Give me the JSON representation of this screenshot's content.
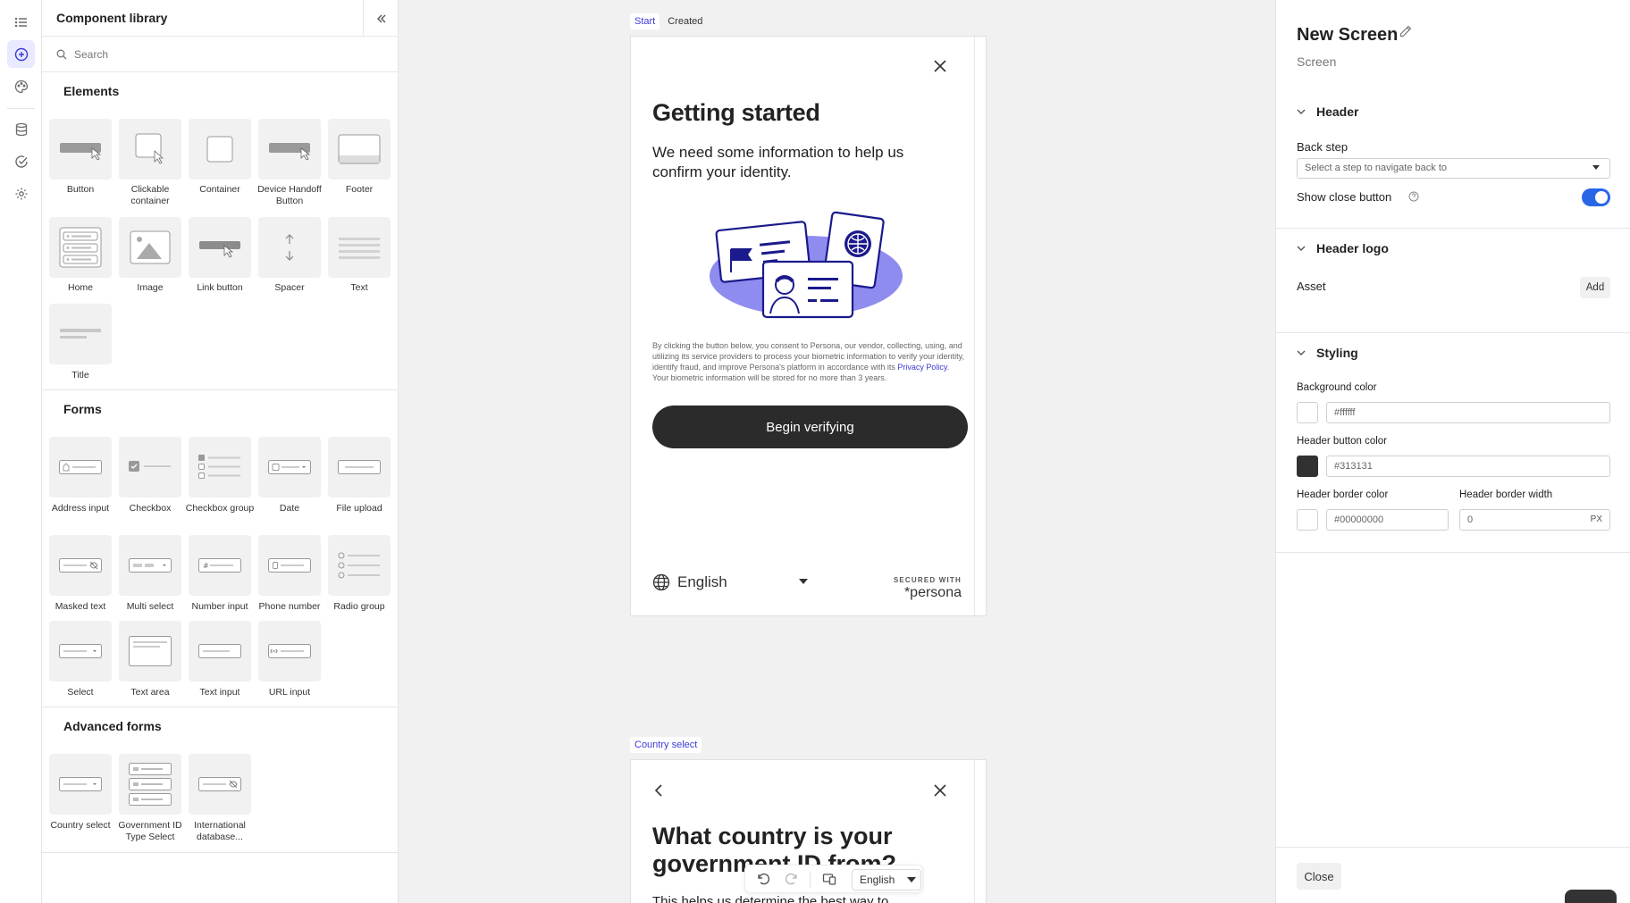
{
  "library": {
    "title": "Component library",
    "search_placeholder": "Search",
    "sections": [
      {
        "title": "Elements",
        "items": [
          "Button",
          "Clickable container",
          "Container",
          "Device Handoff Button",
          "Footer",
          "Home",
          "Image",
          "Link button",
          "Spacer",
          "Text",
          "Title"
        ]
      },
      {
        "title": "Forms",
        "items": [
          "Address input",
          "Checkbox",
          "Checkbox group",
          "Date",
          "File upload",
          "Masked text",
          "Multi select",
          "Number input",
          "Phone number",
          "Radio group",
          "Select",
          "Text area",
          "Text input",
          "URL input"
        ]
      },
      {
        "title": "Advanced forms",
        "items": [
          "Country select",
          "Government ID Type Select",
          "International database..."
        ]
      }
    ]
  },
  "canvas": {
    "screen1": {
      "tabs": [
        "Start",
        "Created"
      ],
      "title": "Getting started",
      "subtitle": "We need some information to help us confirm your identity.",
      "consent_pre": "By clicking the button below, you consent to Persona, our vendor, collecting, using, and utilizing its service providers to process your biometric information to verify your identity, identify fraud, and improve Persona's platform in accordance with its ",
      "consent_link": "Privacy Policy",
      "consent_post": ". Your biometric information will be stored for no more than 3 years.",
      "button": "Begin verifying",
      "language": "English",
      "secured_with": "SECURED WITH",
      "brand": "persona"
    },
    "screen2": {
      "tab": "Country select",
      "title": "What country is your government ID from?",
      "subtitle": "This helps us determine the best way to"
    },
    "toolbar": {
      "language": "English"
    }
  },
  "panel": {
    "title": "New Screen",
    "subtitle": "Screen",
    "header_section": "Header",
    "back_step_label": "Back step",
    "back_step_placeholder": "Select a step to navigate back to",
    "show_close_label": "Show close button",
    "show_close_on": true,
    "logo_section": "Header logo",
    "asset_label": "Asset",
    "add_label": "Add",
    "styling_section": "Styling",
    "bg_color_label": "Background color",
    "bg_color_value": "#ffffff",
    "header_btn_color_label": "Header button color",
    "header_btn_color_value": "#313131",
    "header_border_color_label": "Header border color",
    "header_border_color_value": "#00000000",
    "header_border_width_label": "Header border width",
    "header_border_width_value": "0",
    "px_unit": "PX",
    "close_label": "Close"
  },
  "colors": {
    "accent": "#3b3bd6",
    "toggle": "#2866e8",
    "primary_button": "#2b2b2b",
    "illustration": "#8f8cf0"
  }
}
